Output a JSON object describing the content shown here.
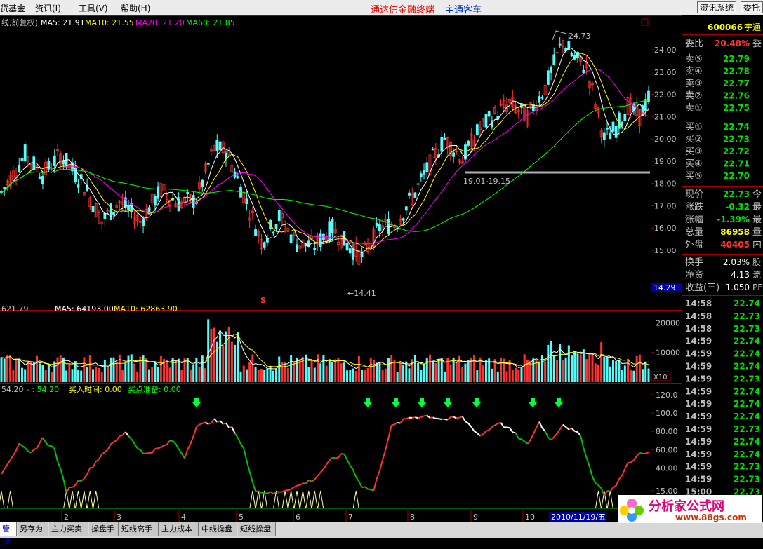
{
  "menubar": {
    "items": [
      "货基金",
      "资讯(I)",
      "工具(V)",
      "帮助(H)"
    ],
    "title_main": "通达信金融终端",
    "title_sub": "宇通客车",
    "btn_news": "资讯系统",
    "btn_trade": "委托"
  },
  "colors": {
    "up": "#ff3232",
    "down": "#54fcfc",
    "ma5": "#ffffff",
    "ma10": "#ffff00",
    "ma20": "#ff00ff",
    "ma60": "#00ff00",
    "axis": "#a00000"
  },
  "main_chart": {
    "header": {
      "prefix": "线,前复权)",
      "ma5": "MA5: 21.91",
      "ma10": "MA10: 21.55",
      "ma20": "MA20: 21.20",
      "ma60": "MA60: 21.85"
    },
    "y_ticks": [
      "24.00",
      "23.00",
      "22.00",
      "21.00",
      "20.00",
      "19.00",
      "18.00",
      "17.00",
      "16.00",
      "15.00"
    ],
    "high_label": "24.73",
    "low_label": "←14.41",
    "range_label": "19.01-19.15",
    "price_box": "14.29",
    "s_marker": "S",
    "close_box": "□"
  },
  "volume_chart": {
    "header": {
      "vol": "621.79",
      "ma5": "MA5: 64193.00",
      "ma10": "MA10: 62863.90"
    },
    "y_ticks": [
      "20000",
      "10000"
    ],
    "unit_box": "X10"
  },
  "indicator_chart": {
    "header": {
      "val1": "54.20",
      "val2": "- : 54.20",
      "buy_time": "买入时间: 0.00",
      "buy_ready": "买点准备: 0.00"
    },
    "y_ticks": [
      "120.0",
      "100.0",
      "80.00",
      "60.00",
      "40.00",
      "15.00"
    ]
  },
  "x_axis": {
    "months": [
      "2",
      "3",
      "4",
      "5",
      "6",
      "7",
      "8",
      "9",
      "10"
    ],
    "cursor_date": "2010/11/19/五"
  },
  "quote_panel": {
    "code": "600066",
    "name": "宇通",
    "weibi_label": "委比",
    "weibi_value": "20.48%",
    "weibi_trail": "委",
    "asks": [
      {
        "label": "卖⑤",
        "price": "22.79"
      },
      {
        "label": "卖④",
        "price": "22.78"
      },
      {
        "label": "卖③",
        "price": "22.77"
      },
      {
        "label": "卖②",
        "price": "22.76"
      },
      {
        "label": "卖①",
        "price": "22.75"
      }
    ],
    "bids": [
      {
        "label": "买①",
        "price": "22.74"
      },
      {
        "label": "买②",
        "price": "22.73"
      },
      {
        "label": "买③",
        "price": "22.72"
      },
      {
        "label": "买④",
        "price": "22.71"
      },
      {
        "label": "买⑤",
        "price": "22.70"
      }
    ],
    "stats": [
      {
        "label": "现价",
        "value": "22.73",
        "trail": "今",
        "color": "#00e000"
      },
      {
        "label": "涨跌",
        "value": "-0.32",
        "trail": "最",
        "color": "#00e000"
      },
      {
        "label": "涨幅",
        "value": "-1.39%",
        "trail": "最",
        "color": "#00e000"
      },
      {
        "label": "总量",
        "value": "86958",
        "trail": "量",
        "color": "#ffff00"
      },
      {
        "label": "外盘",
        "value": "40405",
        "trail": "内",
        "color": "#ff3232"
      }
    ],
    "stats2": [
      {
        "label": "换手",
        "value": "2.03%",
        "trail": "股"
      },
      {
        "label": "净资",
        "value": "4.13",
        "trail": "流"
      },
      {
        "label": "收益(三)",
        "value": "1.050",
        "trail": "PE"
      }
    ],
    "ticks": [
      {
        "time": "14:58",
        "price": "22.74"
      },
      {
        "time": "14:58",
        "price": "22.73"
      },
      {
        "time": "14:58",
        "price": "22.73"
      },
      {
        "time": "14:59",
        "price": "22.74"
      },
      {
        "time": "14:59",
        "price": "22.74"
      },
      {
        "time": "14:59",
        "price": "22.74"
      },
      {
        "time": "14:59",
        "price": "22.73"
      },
      {
        "time": "14:59",
        "price": "22.74"
      },
      {
        "time": "14:59",
        "price": "22.74"
      },
      {
        "time": "14:59",
        "price": "22.74"
      },
      {
        "time": "14:59",
        "price": "22.73"
      },
      {
        "time": "14:59",
        "price": "22.74"
      },
      {
        "time": "14:59",
        "price": "22.74"
      },
      {
        "time": "14:59",
        "price": "22.73"
      },
      {
        "time": "14:59",
        "price": "22.73"
      },
      {
        "time": "15:00",
        "price": "22.73"
      }
    ]
  },
  "tabs": [
    "管理",
    "另存为",
    "主力买卖",
    "操盘手",
    "短线高手",
    "主力成本",
    "中线操盘",
    "短线操盘"
  ],
  "logo": {
    "cn": "分析家公式网",
    "url": "www.88gs.com"
  }
}
